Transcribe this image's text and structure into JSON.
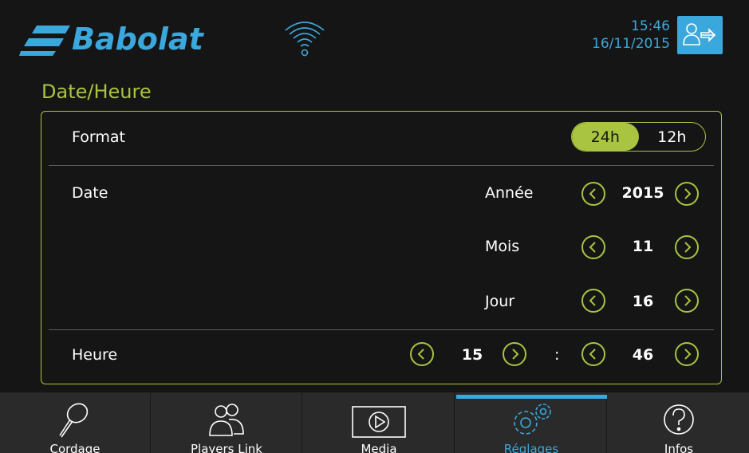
{
  "header": {
    "brand": "Babolat",
    "time": "15:46",
    "date": "16/11/2015"
  },
  "page": {
    "title": "Date/Heure"
  },
  "format": {
    "label": "Format",
    "options": [
      "24h",
      "12h"
    ],
    "selected": "24h"
  },
  "date": {
    "label": "Date",
    "year_label": "Année",
    "year": "2015",
    "month_label": "Mois",
    "month": "11",
    "day_label": "Jour",
    "day": "16"
  },
  "time": {
    "label": "Heure",
    "hour": "15",
    "separator": ":",
    "minute": "46"
  },
  "nav": {
    "items": [
      {
        "label": "Cordage",
        "icon": "racket-icon"
      },
      {
        "label": "Players Link",
        "icon": "players-icon"
      },
      {
        "label": "Media",
        "icon": "play-icon"
      },
      {
        "label": "Réglages",
        "icon": "settings-gears-icon"
      },
      {
        "label": "Infos",
        "icon": "help-icon"
      }
    ],
    "active_index": 3
  },
  "colors": {
    "accent_green": "#a8c441",
    "accent_blue": "#3aa8dc",
    "background": "#151515",
    "navbar": "#2a2a2a"
  }
}
